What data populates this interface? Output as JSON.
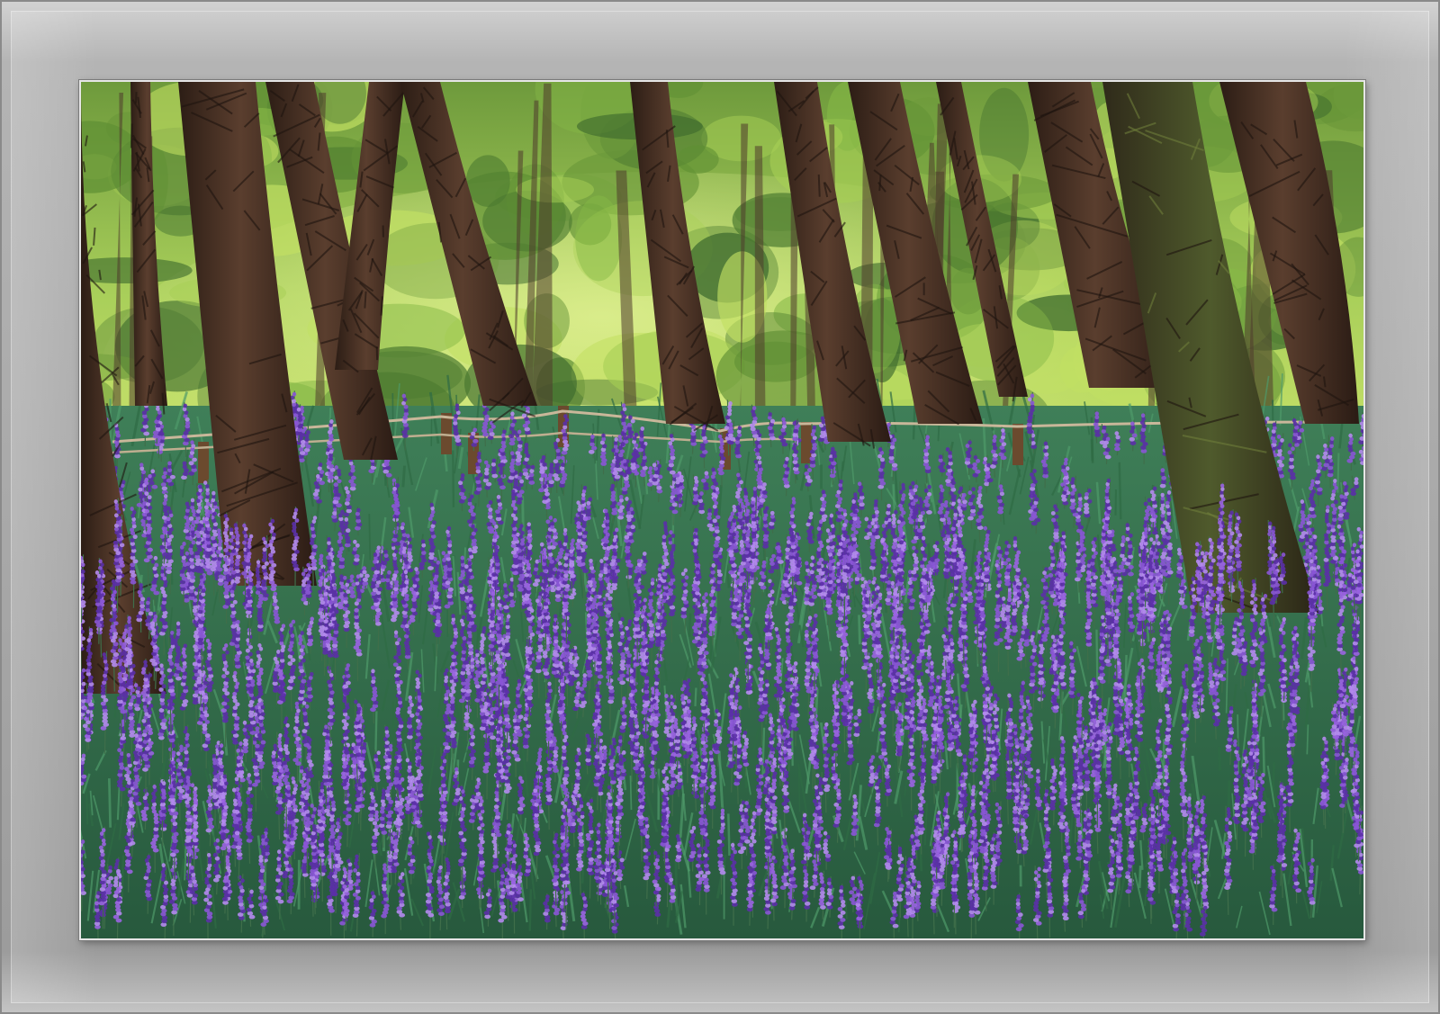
{
  "scene": {
    "subject": "",
    "colors": {
      "flower": "#8a55d6",
      "flower_light": "#b489ee",
      "flower_dark": "#5b2fa8",
      "foliage": "#2f7a4a",
      "canopy": "#9cc94a",
      "trunk": "#4a3226",
      "frame": "#a9a9a9"
    }
  }
}
